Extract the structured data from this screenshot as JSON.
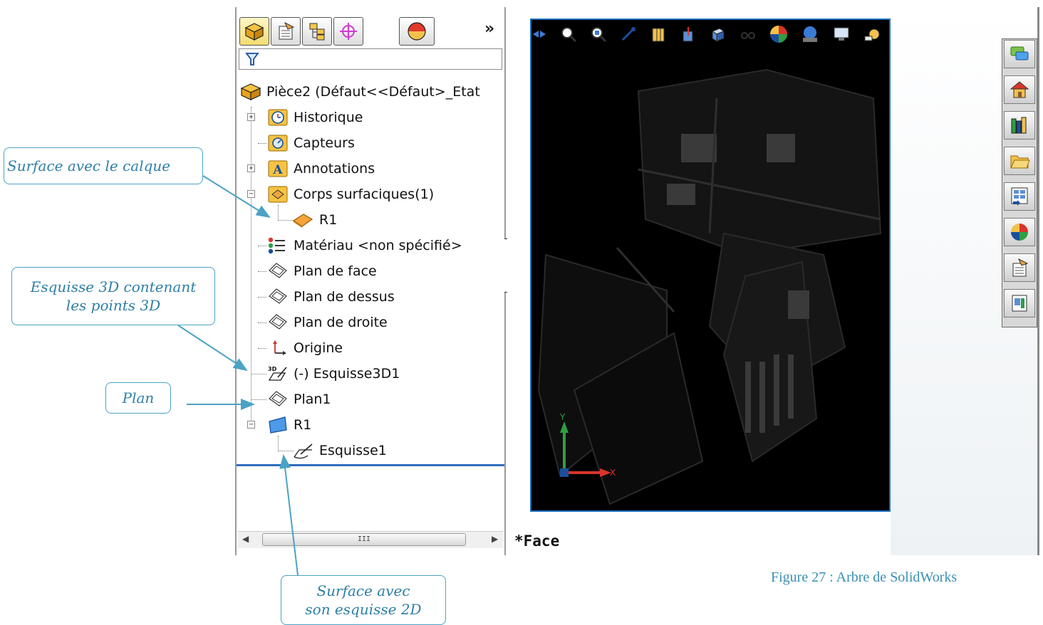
{
  "feature_manager": {
    "tabs": [
      "feature-tree-tab",
      "property-manager-tab",
      "configuration-manager-tab",
      "dimxpert-tab",
      "display-manager-tab"
    ],
    "more_label": "»",
    "tree": [
      {
        "label": "Pièce2  (Défaut<<Défaut>_Etat",
        "icon": "part-icon"
      },
      {
        "label": "Historique",
        "icon": "history-icon"
      },
      {
        "label": "Capteurs",
        "icon": "sensor-icon"
      },
      {
        "label": "Annotations",
        "icon": "annotations-icon"
      },
      {
        "label": "Corps surfaciques(1)",
        "icon": "surface-bodies-folder-icon"
      },
      {
        "label": "R1",
        "icon": "surface-body-icon"
      },
      {
        "label": "Matériau <non spécifié>",
        "icon": "material-icon"
      },
      {
        "label": "Plan de face",
        "icon": "plane-icon"
      },
      {
        "label": "Plan de dessus",
        "icon": "plane-icon"
      },
      {
        "label": "Plan de droite",
        "icon": "plane-icon"
      },
      {
        "label": "Origine",
        "icon": "origin-icon"
      },
      {
        "label": "(-) Esquisse3D1",
        "icon": "3d-sketch-icon"
      },
      {
        "label": "Plan1",
        "icon": "plane-icon"
      },
      {
        "label": "R1",
        "icon": "planar-surface-icon"
      },
      {
        "label": "Esquisse1",
        "icon": "sketch-icon"
      }
    ],
    "scrollbar_grip": "III"
  },
  "graphics": {
    "view_label": "*Face",
    "axis_labels": {
      "x": "X",
      "y": "Y"
    }
  },
  "callouts": {
    "surface_layer": "Surface avec le calque",
    "sketch3d_line1": "Esquisse 3D contenant",
    "sketch3d_line2": "les points 3D",
    "plane": "Plan",
    "surface_sketch_line1": "Surface avec",
    "surface_sketch_line2": "son esquisse 2D"
  },
  "caption": "Figure 27 : Arbre de SolidWorks",
  "colors": {
    "callout_border": "#4aa3c4",
    "callout_text": "#2e7fa5",
    "viewport_outline": "#1f6fbf",
    "tree_separator": "#2f6dbb"
  }
}
